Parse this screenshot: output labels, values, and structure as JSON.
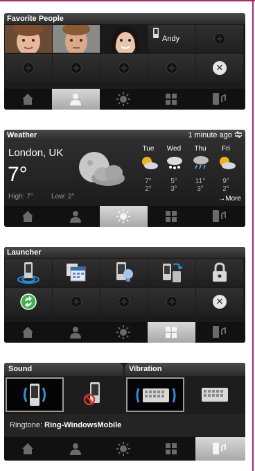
{
  "colors": {
    "frame": "#b0246a",
    "widget_bg": "#2b2b2b",
    "active_tab": "#c8c8c8",
    "sound_icon_accent": "#2f8fd6",
    "launcher_green": "#3fb34f"
  },
  "tab_icons": [
    "home-icon",
    "person-icon",
    "weather-sun-icon",
    "launcher-grid-icon",
    "phone-sound-icon"
  ],
  "favorite_people": {
    "title": "Favorite People",
    "contact_name": "Andy",
    "contact_icon": "phone-icon",
    "active_tab": 1
  },
  "weather": {
    "title": "Weather",
    "updated": "1 minute ago",
    "refresh_icon": "refresh-icon",
    "city": "London, UK",
    "current_temp": "7°",
    "high": "High: 7°",
    "low": "Low: 2°",
    "more": "→More",
    "forecast": [
      {
        "day": "Tue",
        "hi": "7°",
        "lo": "2°",
        "icon": "sun-cloud-icon"
      },
      {
        "day": "Wed",
        "hi": "5°",
        "lo": "3°",
        "icon": "snow-cloud-icon"
      },
      {
        "day": "Thu",
        "hi": "11°",
        "lo": "3°",
        "icon": "rain-cloud-icon"
      },
      {
        "day": "Fri",
        "hi": "9°",
        "lo": "2°",
        "icon": "sun-cloud-icon"
      }
    ],
    "active_tab": 2
  },
  "launcher": {
    "title": "Launcher",
    "items": [
      "phone-signal-icon",
      "calendar-icon",
      "phone-bulb-icon",
      "phone-sync-icon",
      "lock-icon",
      "green-sync-icon"
    ],
    "active_tab": 3
  },
  "sound": {
    "sound_label": "Sound",
    "vibration_label": "Vibration",
    "ringtone_label": "Ringtone:",
    "ringtone_value": "Ring-WindowsMobile",
    "active_tab": 4
  }
}
